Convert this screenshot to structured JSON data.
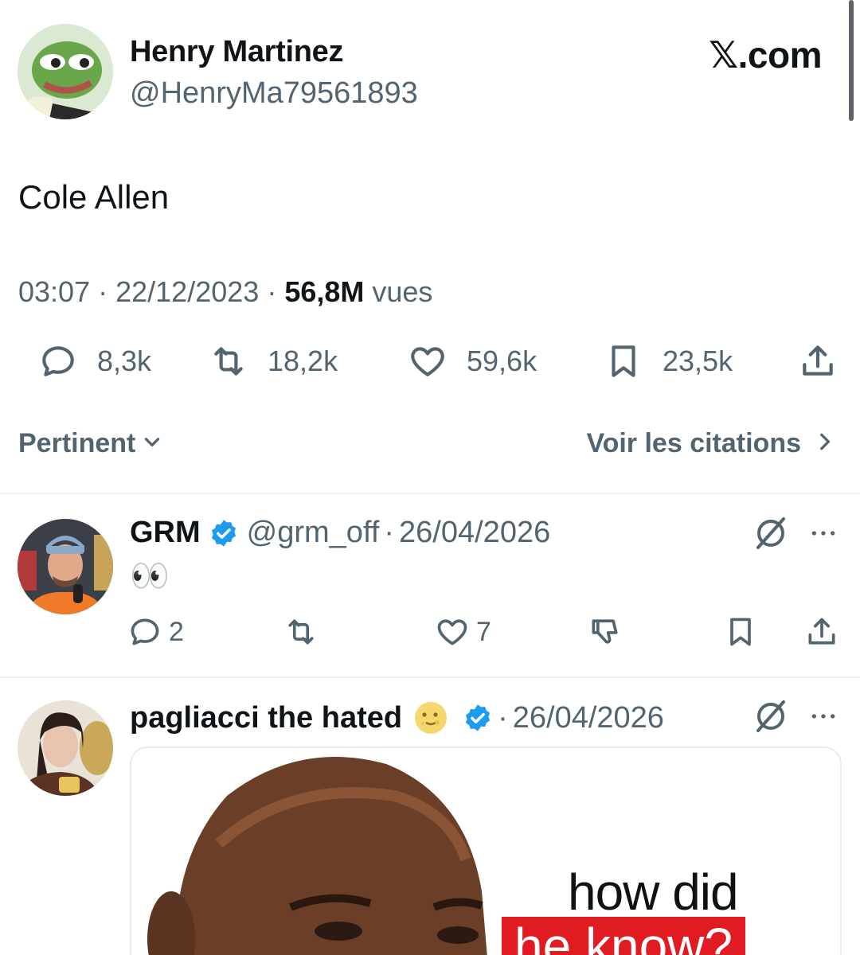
{
  "brand": {
    "label": "𝕏.com"
  },
  "tweet": {
    "author_name": "Henry Martinez",
    "author_handle": "@HenryMa79561893",
    "text": "Cole Allen",
    "time": "03:07",
    "date": "22/12/2023",
    "views_count": "56,8M",
    "views_label": "vues",
    "replies": "8,3k",
    "reposts": "18,2k",
    "likes": "59,6k",
    "bookmarks": "23,5k"
  },
  "sort": {
    "label": "Pertinent"
  },
  "quotes": {
    "label": "Voir les citations"
  },
  "replies": [
    {
      "name": "GRM",
      "handle": "@grm_off",
      "date": "26/04/2026",
      "text": "👀",
      "reply_count": "2",
      "like_count": "7"
    },
    {
      "name": "pagliacci the hated",
      "date": "26/04/2026",
      "media_text_line1": "how did",
      "media_text_line2": "he know?"
    }
  ],
  "colors": {
    "text_primary": "#0f1419",
    "text_secondary": "#536471",
    "verified_blue": "#1d9bf0",
    "divider": "#eff3f4",
    "meme_red": "#e01c22"
  },
  "icons": [
    "reply-icon",
    "repost-icon",
    "like-icon",
    "bookmark-icon",
    "share-icon",
    "dislike-icon",
    "grok-icon",
    "more-icon",
    "verified-badge-icon",
    "chevron-down-icon",
    "chevron-right-icon"
  ]
}
